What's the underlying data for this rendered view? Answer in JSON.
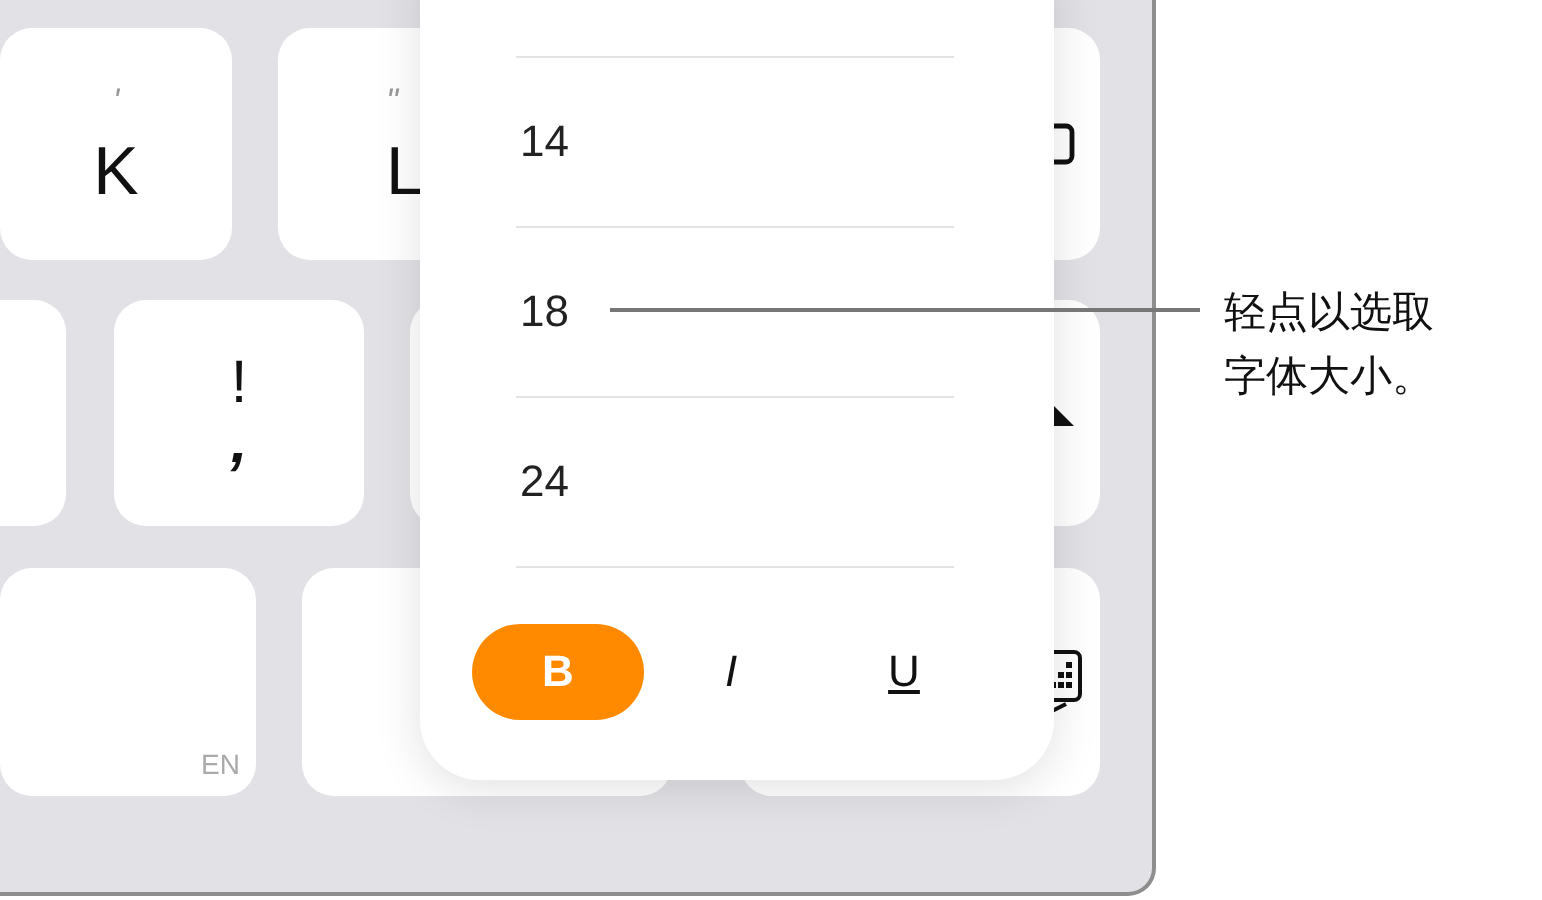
{
  "keyboard": {
    "keys": [
      {
        "kind": "letter",
        "hint": "'",
        "label": "K"
      },
      {
        "kind": "letter",
        "hint": "\"",
        "label": "L"
      },
      {
        "kind": "punct",
        "label": "!",
        "hint": ","
      },
      {
        "kind": "language",
        "label": "EN"
      }
    ]
  },
  "font_size_menu": {
    "sizes": [
      {
        "label": "14"
      },
      {
        "label": "18"
      },
      {
        "label": "24"
      }
    ],
    "styles": [
      {
        "label": "B",
        "kind": "bold",
        "selected": true
      },
      {
        "label": "I",
        "kind": "italic",
        "selected": false
      },
      {
        "label": "U",
        "kind": "underline",
        "selected": false
      }
    ]
  },
  "callout": {
    "text": "轻点以选取字体大小。"
  }
}
